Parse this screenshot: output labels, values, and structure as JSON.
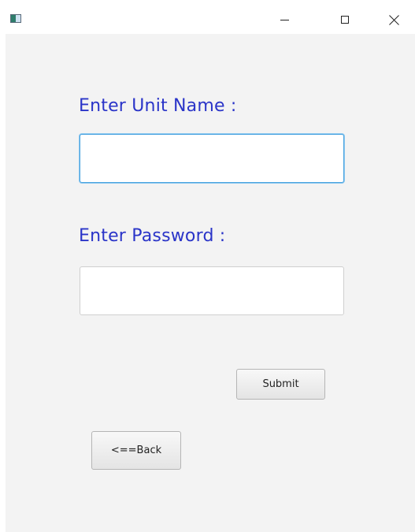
{
  "window": {
    "title": "",
    "controls": {
      "minimize_icon": "minimize-icon",
      "maximize_icon": "maximize-icon",
      "close_icon": "close-icon"
    }
  },
  "form": {
    "unit_label": "Enter Unit Name :",
    "unit_value": "",
    "password_label": "Enter Password :",
    "password_value": "",
    "submit_label": "Submit",
    "back_label": "<==Back"
  },
  "colors": {
    "label_text": "#2a34c8",
    "focus_border": "#4aa3df",
    "background": "#f3f3f3"
  }
}
